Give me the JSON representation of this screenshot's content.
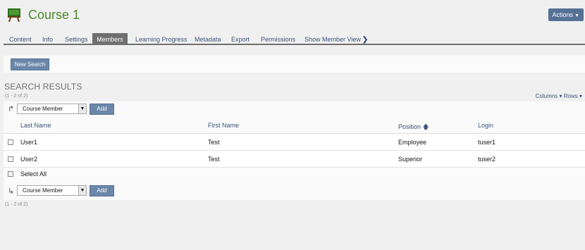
{
  "header": {
    "title": "Course 1",
    "actions_label": "Actions",
    "course_icon": "chalkboard-icon"
  },
  "tabs": [
    {
      "label": "Content",
      "active": false
    },
    {
      "label": "Info",
      "active": false
    },
    {
      "label": "Settings",
      "active": false
    },
    {
      "label": "Members",
      "active": true
    },
    {
      "label": "Learning Progress",
      "active": false
    },
    {
      "label": "Metadata",
      "active": false
    },
    {
      "label": "Export",
      "active": false
    },
    {
      "label": "Permissions",
      "active": false
    },
    {
      "label": "Show Member View",
      "active": false
    }
  ],
  "toolbar": {
    "new_search_label": "New Search"
  },
  "results": {
    "title": "SEARCH RESULTS",
    "range_top": "(1 - 2 of 2)",
    "range_bottom": "(1 - 2 of 2)",
    "columns_label": "Columns",
    "rows_label": "Rows"
  },
  "command": {
    "select_value": "Course Member",
    "add_label": "Add"
  },
  "table": {
    "headers": {
      "last_name": "Last Name",
      "first_name": "First Name",
      "position": "Position",
      "login": "Login"
    },
    "sort_column": "position",
    "rows": [
      {
        "last_name": "User1",
        "first_name": "Test",
        "position": "Employee",
        "login": "tuser1"
      },
      {
        "last_name": "User2",
        "first_name": "Test",
        "position": "Superior",
        "login": "tuser2"
      }
    ],
    "select_all_label": "Select All"
  },
  "colors": {
    "accent_green": "#4b8a2c",
    "button_blue": "#6b87aa",
    "link_blue": "#3a5278",
    "active_tab": "#6f6f6f"
  }
}
